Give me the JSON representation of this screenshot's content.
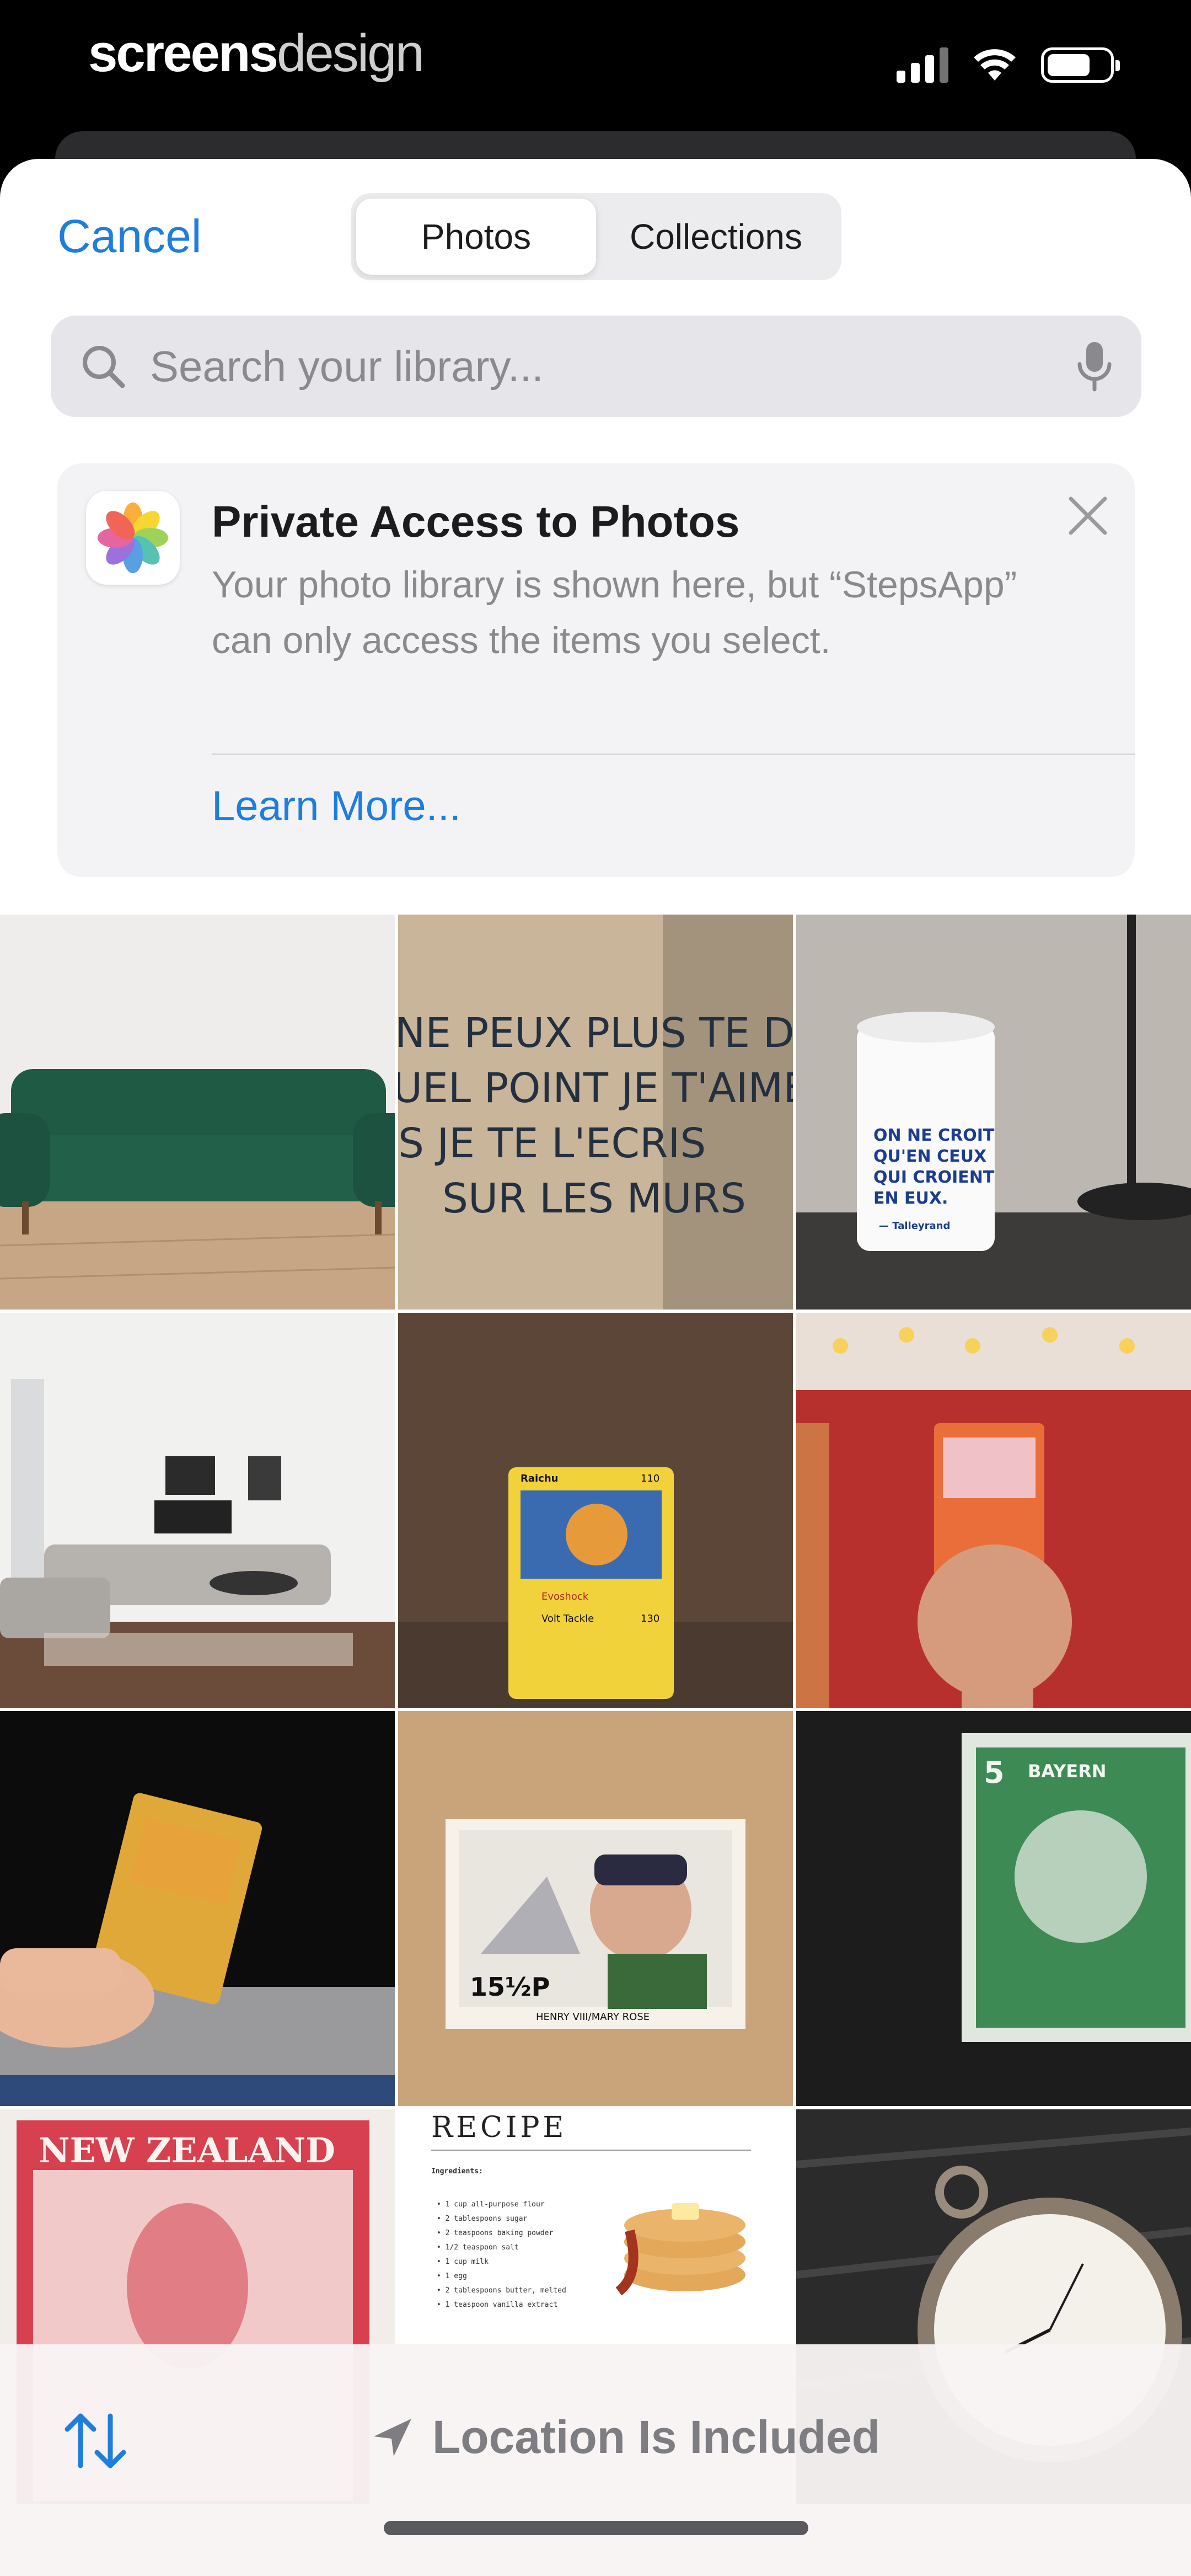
{
  "status_bar": {
    "brand_part1": "screens",
    "brand_part2": "design"
  },
  "header": {
    "cancel_label": "Cancel",
    "tabs": [
      {
        "label": "Photos",
        "active": true
      },
      {
        "label": "Collections",
        "active": false
      }
    ]
  },
  "search": {
    "placeholder": "Search your library...",
    "value": ""
  },
  "notice": {
    "title": "Private Access to Photos",
    "body": "Your photo library is shown here, but “StepsApp” can only access the items you select.",
    "link": "Learn More..."
  },
  "photos": [
    {
      "subject": "green velvet sofa"
    },
    {
      "subject": "graffiti wall",
      "text_lines": [
        "NE PEUX PLUS TE D",
        "UEL POINT JE T'AIME",
        "S JE TE L'ECRIS",
        "SUR LES MURS"
      ]
    },
    {
      "subject": "white mug",
      "text_lines": [
        "ON NE CROIT",
        "QU'EN CEUX",
        "QUI CROIENT",
        "EN EUX.",
        "— Talleyrand"
      ]
    },
    {
      "subject": "living room"
    },
    {
      "subject": "trading card Raichu",
      "text_lines": [
        "Raichu",
        "110",
        "Evoshock",
        "Volt Tackle",
        "130"
      ]
    },
    {
      "subject": "trading card in hand"
    },
    {
      "subject": "trading card in hand over laptop"
    },
    {
      "subject": "postage stamp",
      "text_lines": [
        "15½P",
        "HENRY VIII/MARY ROSE"
      ]
    },
    {
      "subject": "green stamp",
      "text_lines": [
        "5",
        "BAYERN"
      ]
    },
    {
      "subject": "New Zealand stamp",
      "text_lines": [
        "NEW ZEALAND"
      ]
    },
    {
      "subject": "recipe card",
      "text_lines": [
        "RECIPE",
        "Ingredients:",
        "• 1 cup all-purpose flour",
        "• 2 tablespoons sugar",
        "• 2 teaspoons baking powder",
        "• 1/2 teaspoon salt",
        "• 1 cup milk",
        "• 1 egg",
        "• 2 tablespoons butter, melted",
        "• 1 teaspoon vanilla extract"
      ]
    },
    {
      "subject": "pocket watch"
    }
  ],
  "bottom": {
    "location_label": "Location Is Included"
  },
  "colors": {
    "accent": "#1f7ddb",
    "muted": "#8a8a8e"
  }
}
